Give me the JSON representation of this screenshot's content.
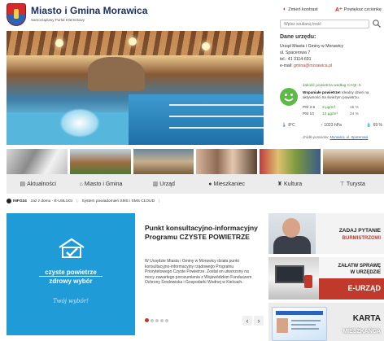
{
  "header": {
    "title": "Miasto i Gmina Morawica",
    "subtitle": "Samorządowy Portal Internetowy",
    "contrast_label": "Zmień kontrast",
    "font_label": "Powiększ czcionkę",
    "search_placeholder": "Wpisz szukaną treść"
  },
  "contact": {
    "heading": "Dane urzędu:",
    "name": "Urząd Miasta i Gminy w Morawicy",
    "street": "ul. Spacerowa 7",
    "phone": "tel.: 41 3114-691",
    "email_label": "e-mail:",
    "email": "gmina@morawica.pl"
  },
  "air_quality": {
    "heading": "Jakość powietrza według CAQI: 5",
    "message_bold": "Wspaniałe powietrze!",
    "message_rest": "Idealny dzień na aktywności na świeżym powietrzu.",
    "rows": [
      {
        "key": "PM 2.5",
        "value": "3 µg/m³",
        "percent": "15 %"
      },
      {
        "key": "PM 10",
        "value": "12 µg/m³",
        "percent": "24 %"
      }
    ],
    "temperature": "8°C",
    "pressure": "1023 hPa",
    "humidity": "69 %",
    "source_prefix": "Źródło pomiarów:",
    "source_link": "Morawica, ul. Spacerowa",
    "face_color": "#5fb84a"
  },
  "nav": {
    "items": [
      {
        "label": "Aktualności",
        "icon": "newspaper-icon",
        "glyph": "▤"
      },
      {
        "label": "Miasto i Gmina",
        "icon": "home-icon",
        "glyph": "⌂"
      },
      {
        "label": "Urząd",
        "icon": "building-icon",
        "glyph": "▥"
      },
      {
        "label": "Mieszkaniec",
        "icon": "user-icon",
        "glyph": "●"
      },
      {
        "label": "Kultura",
        "icon": "theater-icon",
        "glyph": "♜"
      },
      {
        "label": "Turysta",
        "icon": "signpost-icon",
        "glyph": "⊤"
      }
    ]
  },
  "info_bar": {
    "badge": "INFO24",
    "items": [
      "zaż z domu - E-USŁUGI",
      "|",
      "System powiadomień SMS i SMS CLOUD",
      "|"
    ]
  },
  "news": {
    "image_line1": "czyste powietrze",
    "image_line2": "zdrowy wybór",
    "image_tagline": "Twój wybór!",
    "title": "Punkt konsultacyjno-informacyjny Programu CZYSTE POWIETRZE",
    "body": "W Urzędzie Miasta i Gminy w Morawicy działa punkt konsultacyjno-informacyjny rządowego Programu Priorytetowego Czyste Powietrze. Został on utworzony na mocy zawartego porozumienia z Wojewódzkim Funduszem Ochrony Środowiska i Gospodarki Wodnej w Kielcach.",
    "prev_label": "‹",
    "next_label": "›"
  },
  "side_tiles": {
    "tile1_line1": "ZADAJ PYTANIE",
    "tile1_line2": "BURMISTRZOWI",
    "tile2_line1": "ZAŁATW SPRAWĘ",
    "tile2_line2": "W URZĘDZIE",
    "tile2_line3": "E-URZĄD",
    "tile3_line1": "KARTA",
    "tile3_line2": "MIESZKAŃCA"
  },
  "colors": {
    "brand_red": "#c0392b",
    "brand_blue": "#1b2f63",
    "news_blue": "#1f9bd8",
    "air_green": "#5fb84a"
  }
}
